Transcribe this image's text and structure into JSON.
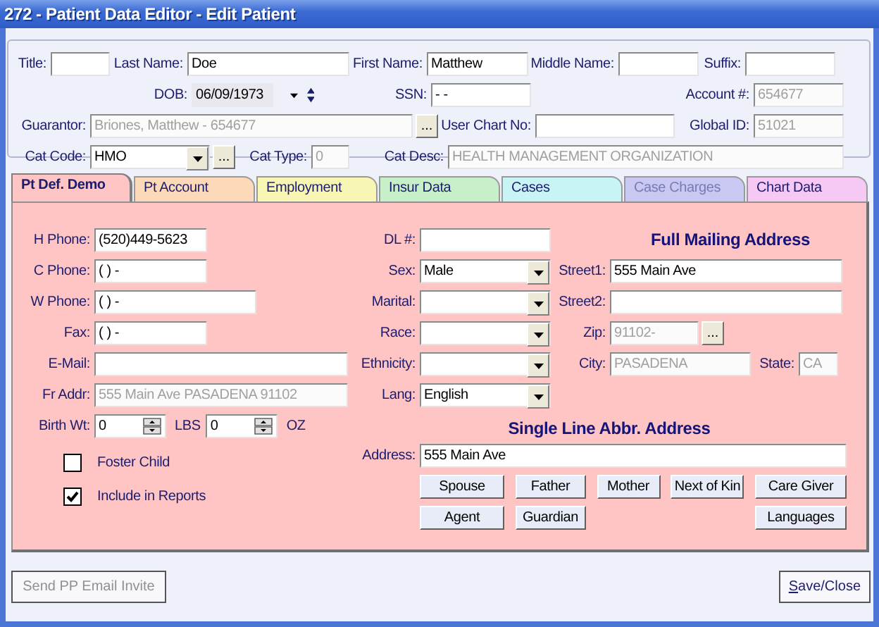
{
  "window": {
    "title": "272 - Patient Data Editor - Edit Patient"
  },
  "header": {
    "rows": [
      {
        "fields": [
          {
            "label": "Title:",
            "kind": "text"
          },
          {
            "label": "Last Name:",
            "kind": "text",
            "value": "Doe"
          },
          {
            "label": "First Name:",
            "kind": "text",
            "value": "Matthew"
          },
          {
            "label": "Middle Name:",
            "kind": "text"
          },
          {
            "label": "Suffix:",
            "kind": "text"
          }
        ]
      },
      {
        "fields": [
          {
            "label": "DOB:",
            "kind": "date",
            "value": "06/09/1973"
          },
          {
            "label": "SSN:",
            "kind": "text",
            "value": "- -"
          },
          {
            "label": "Account #:",
            "kind": "text",
            "value": "654677",
            "disabled": true
          }
        ]
      },
      {
        "fields": [
          {
            "label": "Guarantor:",
            "kind": "browse",
            "value": "Briones, Matthew - 654677",
            "button": "...",
            "disabled": true
          },
          {
            "label": "User Chart No:",
            "kind": "text"
          },
          {
            "label": "Global ID:",
            "kind": "text",
            "value": "51021",
            "disabled": true
          }
        ]
      },
      {
        "fields": [
          {
            "label": "Cat Code:",
            "kind": "combo_browse",
            "value": "HMO",
            "button": "..."
          },
          {
            "label": "Cat Type:",
            "kind": "text",
            "value": "0",
            "disabled": true
          },
          {
            "label": "Cat Desc:",
            "kind": "text",
            "value": "HEALTH MANAGEMENT ORGANIZATION",
            "disabled": true
          }
        ]
      }
    ]
  },
  "tabs": [
    {
      "label": "Pt Def. Demo",
      "color": "#ffc4c4",
      "selected": true,
      "disabled": false
    },
    {
      "label": "Pt Account",
      "color": "#fcd9b8",
      "selected": false,
      "disabled": false
    },
    {
      "label": "Employment",
      "color": "#f8f6b4",
      "selected": false,
      "disabled": false
    },
    {
      "label": "Insur Data",
      "color": "#c8f0c8",
      "selected": false,
      "disabled": false
    },
    {
      "label": "Cases",
      "color": "#c8f4f6",
      "selected": false,
      "disabled": false
    },
    {
      "label": "Case Charges",
      "color": "#c8c8f2",
      "selected": false,
      "disabled": true
    },
    {
      "label": "Chart Data",
      "color": "#f6c8f4",
      "selected": false,
      "disabled": false
    }
  ],
  "panel": {
    "left_fields": [
      {
        "label": "H Phone:",
        "kind": "text",
        "value": "(520)449-5623"
      },
      {
        "label": "C Phone:",
        "kind": "text",
        "value": "(  )  -"
      },
      {
        "label": "W Phone:",
        "kind": "text",
        "value": "(  )  -"
      },
      {
        "label": "Fax:",
        "kind": "text",
        "value": "(  )  -"
      },
      {
        "label": "E-Mail:",
        "kind": "text"
      },
      {
        "label": "Fr Addr:",
        "kind": "text",
        "value": "555 Main Ave PASADENA  91102",
        "disabled": true
      }
    ],
    "birth_weight": {
      "label": "Birth Wt:",
      "parts": [
        {
          "value": "0",
          "unit": "LBS"
        },
        {
          "value": "0",
          "unit": "OZ"
        }
      ]
    },
    "checkboxes": [
      {
        "label": "Foster Child",
        "checked": false
      },
      {
        "label": "Include in Reports",
        "checked": true
      }
    ],
    "middle_fields": [
      {
        "label": "DL #:",
        "kind": "text"
      },
      {
        "label": "Sex:",
        "kind": "combo",
        "value": "Male"
      },
      {
        "label": "Marital:",
        "kind": "combo"
      },
      {
        "label": "Race:",
        "kind": "combo"
      },
      {
        "label": "Ethnicity:",
        "kind": "combo"
      },
      {
        "label": "Lang:",
        "kind": "combo",
        "value": "English"
      }
    ],
    "mailing_address": {
      "title": "Full Mailing Address",
      "rows": [
        {
          "fields": [
            {
              "label": "Street1:",
              "kind": "text",
              "value": "555 Main Ave"
            }
          ]
        },
        {
          "fields": [
            {
              "label": "Street2:",
              "kind": "text"
            }
          ]
        },
        {
          "fields": [
            {
              "label": "Zip:",
              "kind": "browse",
              "value": "91102-",
              "button": "...",
              "disabled": true
            }
          ]
        },
        {
          "fields": [
            {
              "label": "City:",
              "kind": "text",
              "value": "PASADENA",
              "disabled": true
            },
            {
              "label": "State:",
              "kind": "text",
              "value": "CA",
              "disabled": true
            }
          ]
        }
      ]
    },
    "single_line": {
      "title": "Single Line Abbr. Address",
      "label": "Address:",
      "value": "555 Main Ave"
    },
    "buttons": [
      [
        "Spouse",
        "Father",
        "Mother",
        "Next of Kin",
        "Care Giver"
      ],
      [
        "Agent",
        "Guardian",
        "Languages"
      ]
    ]
  },
  "footer": {
    "buttons": [
      {
        "label": "Send PP Email Invite",
        "disabled": true
      },
      {
        "label": "Save/Close",
        "disabled": false
      }
    ]
  }
}
